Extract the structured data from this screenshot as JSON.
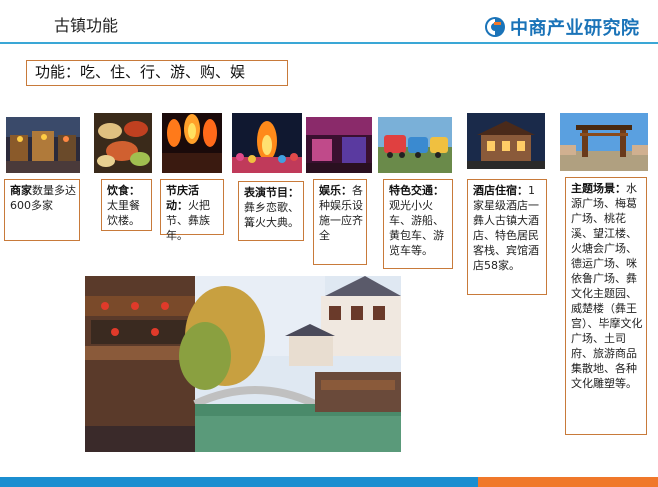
{
  "header": {
    "title": "古镇功能",
    "logo_text": "中商产业研究院",
    "colors": {
      "accent": "#3aa7d6",
      "brand": "#1a73b8",
      "border": "#c87a3a",
      "orange": "#f0782a"
    }
  },
  "function_box": {
    "text": "功能：吃、住、行、游、购、娱"
  },
  "cards": [
    {
      "title": "商家",
      "desc": "数量多达600多家"
    },
    {
      "title": "饮食：",
      "desc": "太里餐饮楼。"
    },
    {
      "title": "节庆活动：",
      "desc": "火把节、彝族年。"
    },
    {
      "title": "表演节目：",
      "desc": "彝乡恋歌、篝火大典。"
    },
    {
      "title": "娱乐：",
      "desc": "各种娱乐设施一应齐全"
    },
    {
      "title": "特色交通：",
      "desc": "观光小火车、游船、黄包车、游览车等。"
    },
    {
      "title": "酒店住宿：",
      "desc": "1家星级酒店一彝人古镇大酒店、特色居民客栈、宾馆酒店58家。"
    },
    {
      "title": "主题场景：",
      "desc": "水源广场、梅葛广场、桃花溪、望江楼、火塘会广场、德运广场、咪依鲁广场、彝文化主题园、威楚楼（彝王宫）、毕摩文化广场、土司府、旅游商品集散地、各种文化雕塑等。"
    }
  ]
}
